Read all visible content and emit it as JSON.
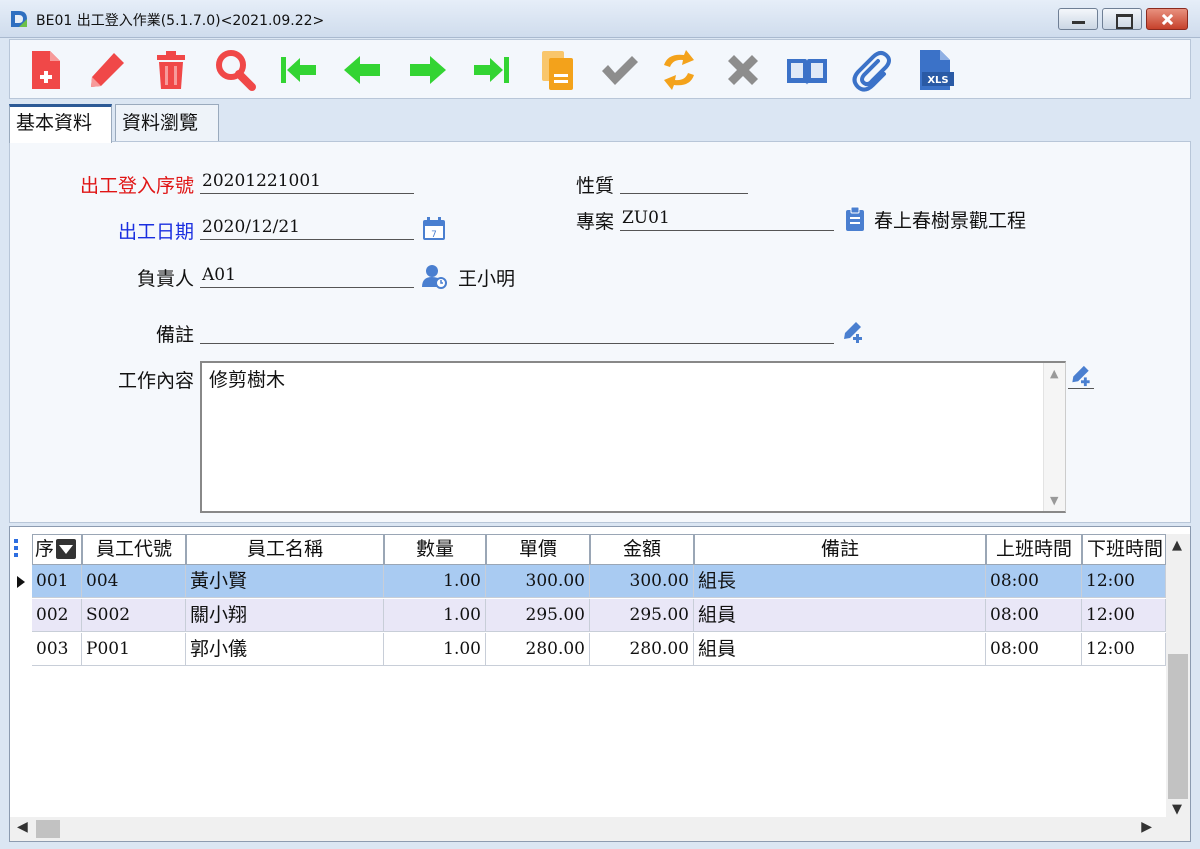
{
  "window": {
    "title": "BE01 出工登入作業(5.1.7.0)<2021.09.22>"
  },
  "toolbar": {
    "buttons": [
      {
        "name": "new",
        "icon": "new-document-icon"
      },
      {
        "name": "edit",
        "icon": "pencil-icon"
      },
      {
        "name": "delete",
        "icon": "trash-icon"
      },
      {
        "name": "search",
        "icon": "magnifier-icon"
      },
      {
        "name": "first",
        "icon": "first-record-icon"
      },
      {
        "name": "previous",
        "icon": "previous-record-icon"
      },
      {
        "name": "next",
        "icon": "next-record-icon"
      },
      {
        "name": "last",
        "icon": "last-record-icon"
      },
      {
        "name": "copy",
        "icon": "copy-icon"
      },
      {
        "name": "confirm",
        "icon": "check-icon"
      },
      {
        "name": "refresh",
        "icon": "refresh-icon"
      },
      {
        "name": "cancel",
        "icon": "cancel-icon"
      },
      {
        "name": "view",
        "icon": "book-icon"
      },
      {
        "name": "attach",
        "icon": "paperclip-icon"
      },
      {
        "name": "excel",
        "icon": "xls-icon"
      }
    ],
    "colors": {
      "red": "#f04848",
      "green": "#33d433",
      "orange": "#f3a21b",
      "gray": "#8d8d8d",
      "blue": "#3b72c8"
    }
  },
  "tabs": [
    {
      "label": "基本資料"
    },
    {
      "label": "資料瀏覽"
    }
  ],
  "form": {
    "serial_label": "出工登入序號",
    "serial_value": "20201221001",
    "date_label": "出工日期",
    "date_value": "2020/12/21",
    "owner_label": "負責人",
    "owner_value": "A01",
    "owner_name": "王小明",
    "nature_label": "性質",
    "nature_value": "",
    "project_label": "專案",
    "project_value": "ZU01",
    "project_name": "春上春樹景觀工程",
    "remark_label": "備註",
    "remark_value": "",
    "work_label": "工作內容",
    "work_value": "修剪樹木"
  },
  "grid": {
    "headers": [
      "序..",
      "員工代號",
      "員工名稱",
      "數量",
      "單價",
      "金額",
      "備註",
      "上班時間",
      "下班時間"
    ],
    "rows": [
      {
        "seq": "001",
        "emp_id": "004",
        "emp_name": "黃小賢",
        "qty": "1.00",
        "price": "300.00",
        "amount": "300.00",
        "remark": "組長",
        "start": "08:00",
        "end": "12:00"
      },
      {
        "seq": "002",
        "emp_id": "S002",
        "emp_name": "關小翔",
        "qty": "1.00",
        "price": "295.00",
        "amount": "295.00",
        "remark": "組員",
        "start": "08:00",
        "end": "12:00"
      },
      {
        "seq": "003",
        "emp_id": "P001",
        "emp_name": "郭小儀",
        "qty": "1.00",
        "price": "280.00",
        "amount": "280.00",
        "remark": "組員",
        "start": "08:00",
        "end": "12:00"
      }
    ]
  }
}
